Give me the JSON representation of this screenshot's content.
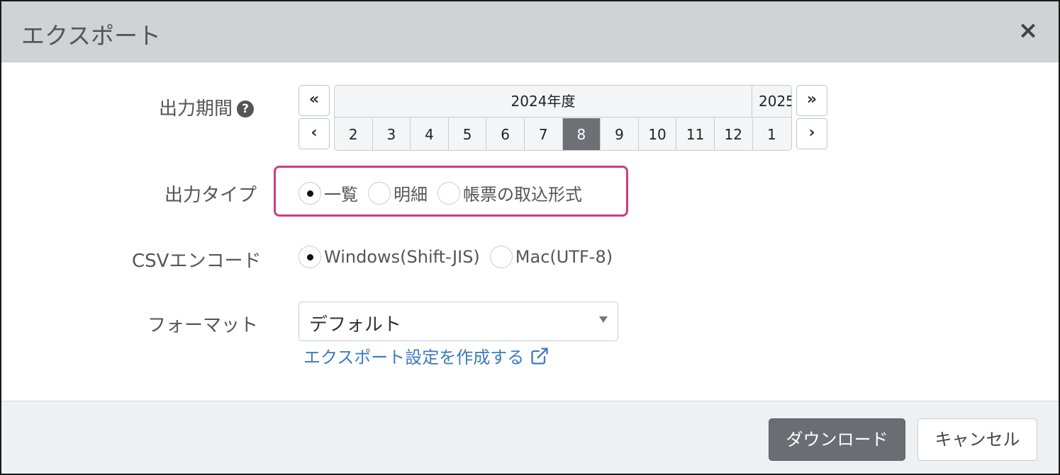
{
  "dialog": {
    "title": "エクスポート",
    "close_icon": "close-icon"
  },
  "period": {
    "label": "出力期間",
    "help_icon": "question-circle-icon",
    "help_glyph": "?",
    "prev_year": "«",
    "next_year": "»",
    "prev_month": "‹",
    "next_month": "›",
    "current_year": "2024年度",
    "next_year_label": "2025",
    "months": [
      "2",
      "3",
      "4",
      "5",
      "6",
      "7",
      "8",
      "9",
      "10",
      "11",
      "12",
      "1"
    ],
    "selected_month": "8"
  },
  "output_type": {
    "label": "出力タイプ",
    "options": [
      "一覧",
      "明細",
      "帳票の取込形式"
    ],
    "selected": "一覧",
    "highlight_color": "#cc3f7f"
  },
  "csv_encoding": {
    "label": "CSVエンコード",
    "options": [
      "Windows(Shift-JIS)",
      "Mac(UTF-8)"
    ],
    "selected": "Windows(Shift-JIS)"
  },
  "format": {
    "label": "フォーマット",
    "value": "デフォルト",
    "link_text": "エクスポート設定を作成する",
    "link_icon": "external-link-icon"
  },
  "footer": {
    "download_label": "ダウンロード",
    "cancel_label": "キャンセル"
  },
  "colors": {
    "header_bg": "#d0d3d6",
    "footer_bg": "#eef1f4",
    "primary_button": "#6a6e72",
    "selected_month": "#6d7175",
    "link": "#3a7bbf"
  }
}
